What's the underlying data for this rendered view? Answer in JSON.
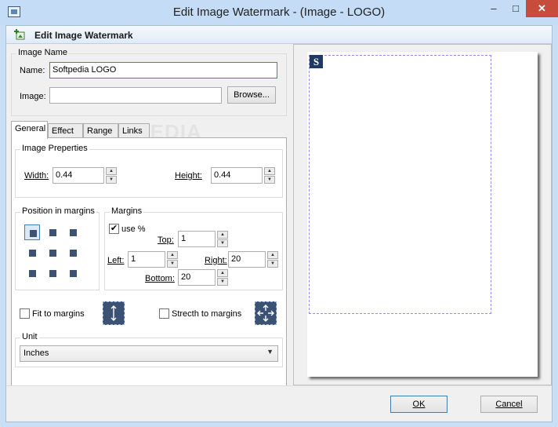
{
  "window": {
    "title": "Edit Image Watermark - (Image - LOGO)",
    "minimize": "–",
    "maximize": "□",
    "close": "✕"
  },
  "header": {
    "title": "Edit Image Watermark",
    "icon": "add-image-icon"
  },
  "image_name_group": {
    "title": "Image Name",
    "name_label": "Name:",
    "name_value": "Softpedia LOGO",
    "image_label": "Image:",
    "image_value": "",
    "browse_label": "Browse..."
  },
  "tabs": [
    {
      "label": "General",
      "active": true
    },
    {
      "label": "Effect"
    },
    {
      "label": "Range"
    },
    {
      "label": "Links"
    }
  ],
  "general": {
    "properties_title": "Image Preperties",
    "width_label": "Width:",
    "width_value": "0.44",
    "height_label": "Height:",
    "height_value": "0.44",
    "position_title": "Position in margins",
    "margins_title": "Margins",
    "use_percent_label": "use %",
    "use_percent_checked": true,
    "top_label": "Top:",
    "top_value": "1",
    "left_label": "Left:",
    "left_value": "1",
    "right_label": "Right:",
    "right_value": "20",
    "bottom_label": "Bottom:",
    "bottom_value": "20",
    "fit_label": "Fit to margins",
    "stretch_label": "Strecth to margins",
    "unit_title": "Unit",
    "unit_value": "Inches"
  },
  "preview": {
    "logo_letter": "S"
  },
  "watermark_text": "SOFTPEDIA",
  "footer": {
    "ok_label": "OK",
    "cancel_label": "Cancel"
  }
}
